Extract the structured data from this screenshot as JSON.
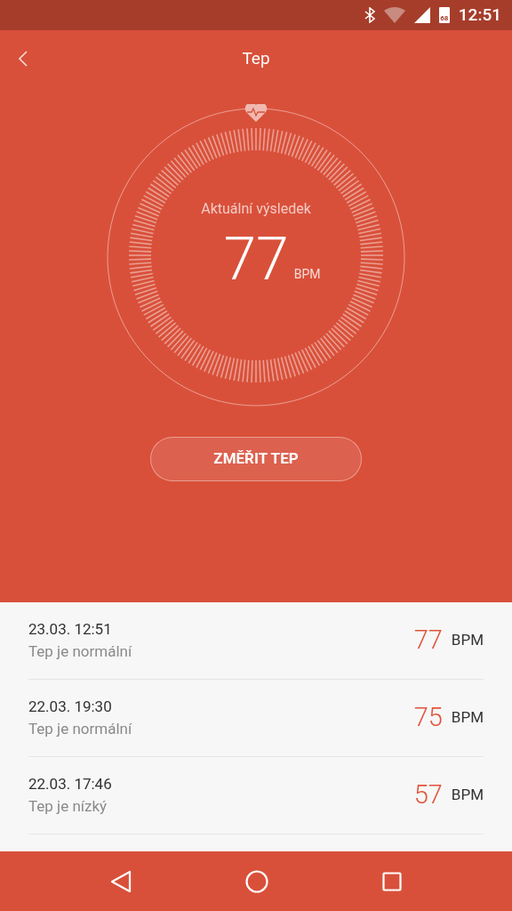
{
  "status_bar": {
    "battery": "68",
    "time": "12:51"
  },
  "header": {
    "title": "Tep"
  },
  "dial": {
    "label": "Aktuální výsledek",
    "value": "77",
    "unit": "BPM"
  },
  "measure_button": {
    "label": "ZMĚŘIT TEP"
  },
  "history": [
    {
      "datetime": "23.03. 12:51",
      "status": "Tep je normální",
      "value": "77",
      "unit": "BPM"
    },
    {
      "datetime": "22.03. 19:30",
      "status": "Tep je normální",
      "value": "75",
      "unit": "BPM"
    },
    {
      "datetime": "22.03. 17:46",
      "status": "Tep je nízký",
      "value": "57",
      "unit": "BPM"
    }
  ]
}
